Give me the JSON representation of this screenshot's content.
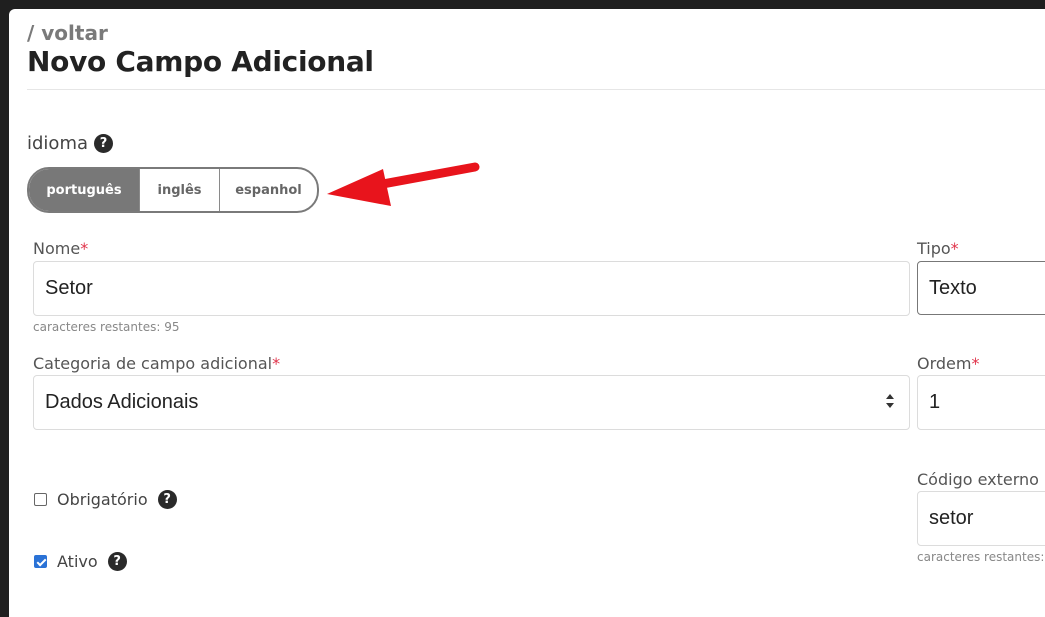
{
  "header": {
    "back_label": "/ voltar",
    "title": "Novo Campo Adicional"
  },
  "language": {
    "label": "idioma",
    "help_icon": "question-circle-icon",
    "options": [
      "português",
      "inglês",
      "espanhol"
    ],
    "selected": "português"
  },
  "fields": {
    "nome": {
      "label": "Nome",
      "required_mark": "*",
      "value": "Setor",
      "hint": "caracteres restantes: 95"
    },
    "tipo": {
      "label": "Tipo",
      "required_mark": "*",
      "value": "Texto"
    },
    "categoria": {
      "label": "Categoria de campo adicional",
      "required_mark": "*",
      "value": "Dados Adicionais"
    },
    "ordem": {
      "label": "Ordem",
      "required_mark": "*",
      "value": "1"
    },
    "codigo_externo": {
      "label": "Código externo",
      "value": "setor",
      "hint": "caracteres restantes:"
    }
  },
  "checkboxes": {
    "obrigatorio": {
      "label": "Obrigatório",
      "checked": false
    },
    "ativo": {
      "label": "Ativo",
      "checked": true
    }
  },
  "colors": {
    "accent": "#2a72d6",
    "required": "#e0344b",
    "annotation_arrow": "#e8141c",
    "segment_active": "#787878"
  }
}
